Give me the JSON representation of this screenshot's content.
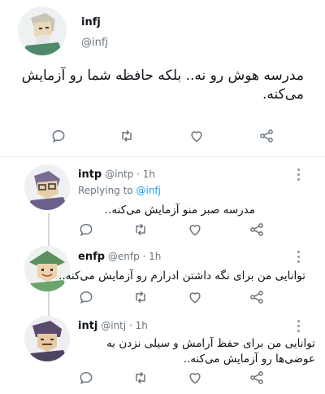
{
  "main_tweet": {
    "name": "infj",
    "handle": "@infj",
    "text": "مدرسه هوش رو نه.. بلکه حافظه شما رو آزمایش می‌کنه."
  },
  "replies": [
    {
      "name": "intp",
      "meta": "@intp · 1h",
      "replying_prefix": "Replying to",
      "replying_to": "@infj",
      "text": "مدرسه صبر منو آزمایش می‌کنه.."
    },
    {
      "name": "enfp",
      "meta": "@enfp · 1h",
      "text": "توانایی من برای نگه داشتن ادرارم رو آزمایش می‌کنه.."
    },
    {
      "name": "intj",
      "meta": "@intj · 1h",
      "text": "توانایی من برای حفظ آرامش و سیلی نزدن به عوضی‌ها رو آزمایش می‌کنه.."
    }
  ],
  "icons": {
    "reply": "reply-icon",
    "retweet": "retweet-icon",
    "like": "heart-icon",
    "share": "share-icon",
    "more": "more-options-icon"
  },
  "colors": {
    "text": "#0f1419",
    "secondary": "#6b7680",
    "link": "#1d9bf0",
    "icon": "#8b98a5"
  }
}
